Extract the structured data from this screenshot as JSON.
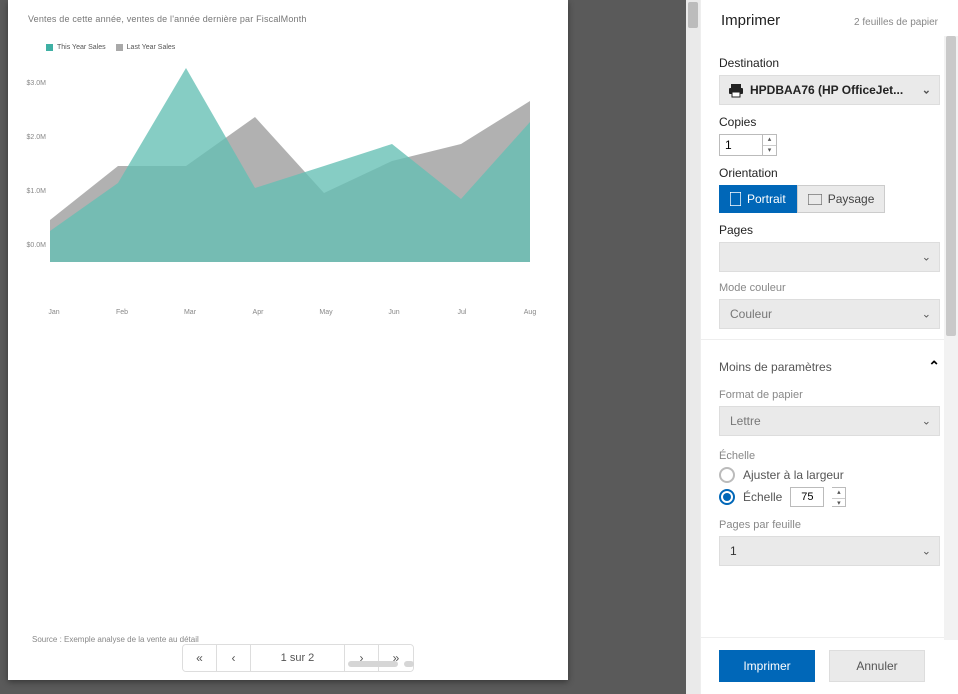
{
  "page": {
    "title": "Ventes de cette année, ventes de l'année dernière par FiscalMonth",
    "footer": "Source : Exemple analyse de la vente au détail"
  },
  "chart_data": {
    "type": "area",
    "title": "",
    "xlabel": "",
    "ylabel": "",
    "ylim": [
      0,
      4000000
    ],
    "y_ticks": [
      "$3.0M",
      "$2.0M",
      "$1.0M",
      "$0.0M"
    ],
    "legend": [
      "This Year Sales",
      "Last Year Sales"
    ],
    "colors": {
      "this_year": "#3fb0a4",
      "last_year": "#a9a9a9"
    },
    "categories": [
      "Jan",
      "Feb",
      "Mar",
      "Apr",
      "May",
      "Jun",
      "Jul",
      "Aug"
    ],
    "series": [
      {
        "name": "This Year Sales",
        "values": [
          700000,
          1600000,
          3700000,
          1500000,
          1900000,
          2300000,
          1300000,
          2700000
        ]
      },
      {
        "name": "Last Year Sales",
        "values": [
          900000,
          1900000,
          1900000,
          2800000,
          1400000,
          2000000,
          2300000,
          3100000
        ]
      }
    ]
  },
  "pagination": {
    "first": "«",
    "prev": "‹",
    "label": "1 sur 2",
    "next": "›",
    "last": "»"
  },
  "panel": {
    "title": "Imprimer",
    "sheet_count": "2 feuilles de papier",
    "destination_label": "Destination",
    "destination_value": "HPDBAA76 (HP OfficeJet...",
    "copies_label": "Copies",
    "copies_value": "1",
    "orientation_label": "Orientation",
    "portrait": "Portrait",
    "landscape": "Paysage",
    "pages_label": "Pages",
    "pages_value": "",
    "color_mode_label": "Mode couleur",
    "color_mode_value": "Couleur",
    "more_params": "Moins de paramètres",
    "paper_format_label": "Format de papier",
    "paper_format_value": "Lettre",
    "scale_label": "Échelle",
    "scale_fit": "Ajuster à la largeur",
    "scale_custom_label": "Échelle",
    "scale_value": "75",
    "pages_per_sheet_label": "Pages par feuille",
    "pages_per_sheet_value": "1",
    "print_button": "Imprimer",
    "cancel_button": "Annuler"
  }
}
